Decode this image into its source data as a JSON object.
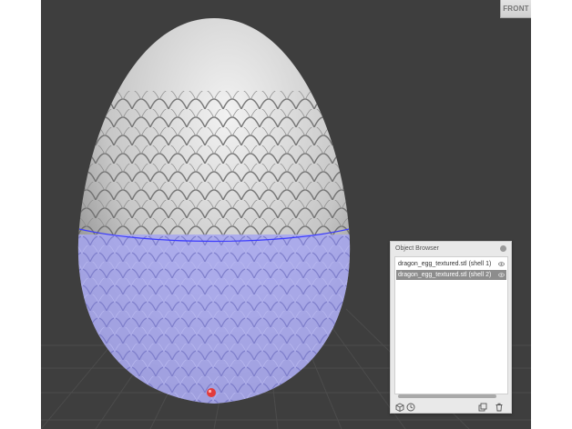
{
  "viewport": {
    "view_cube_label": "FRONT",
    "background_color": "#3e3e3e",
    "model_color": "#c4c4c4",
    "selection_color": "#9a9ae8",
    "marker_color": "#e23b3b"
  },
  "object_browser": {
    "title": "Object Browser",
    "items": [
      {
        "label": "dragon_egg_textured.stl (shell 1)",
        "selected": false,
        "icon": "visibility-icon"
      },
      {
        "label": "dragon_egg_textured.stl (shell 2)",
        "selected": true,
        "icon": "visibility-icon"
      }
    ],
    "toolbar_icons": [
      "cube-icon",
      "clock-icon",
      "duplicate-icon",
      "trash-icon"
    ]
  }
}
